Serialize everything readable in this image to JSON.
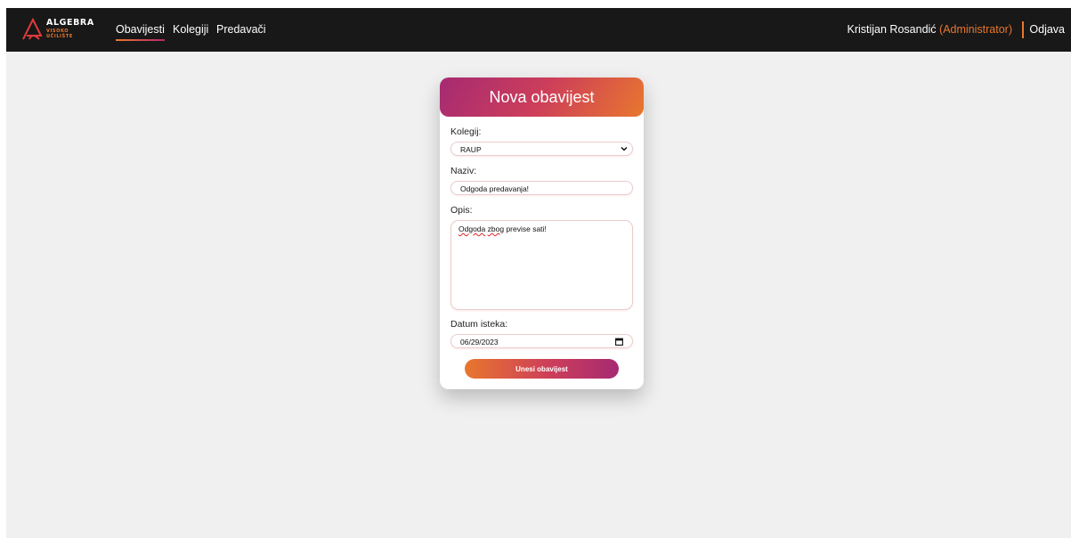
{
  "app": {
    "logo_title": "ALGEBRA",
    "logo_sub_1": "VISOKO",
    "logo_sub_2": "UČILIŠTE",
    "accent_color": "#e8772e",
    "accent_color_2": "#a62a72"
  },
  "nav": {
    "items": [
      {
        "label": "Obavijesti",
        "active": true
      },
      {
        "label": "Kolegiji",
        "active": false
      },
      {
        "label": "Predavači",
        "active": false
      }
    ],
    "user_name": "Kristijan Rosandić",
    "user_role": "(Administrator)",
    "logout_label": "Odjava"
  },
  "form": {
    "title": "Nova obavijest",
    "kolegij_label": "Kolegij:",
    "kolegij_value": "RAUP",
    "naziv_label": "Naziv:",
    "naziv_value": "Odgoda predavanja!",
    "opis_label": "Opis:",
    "opis_value_word1": "Odgoda",
    "opis_value_word2": "zbog",
    "opis_value_rest": "previse sati!",
    "datum_label": "Datum isteka:",
    "datum_value": "06/29/2023",
    "submit_label": "Unesi obavijest"
  }
}
